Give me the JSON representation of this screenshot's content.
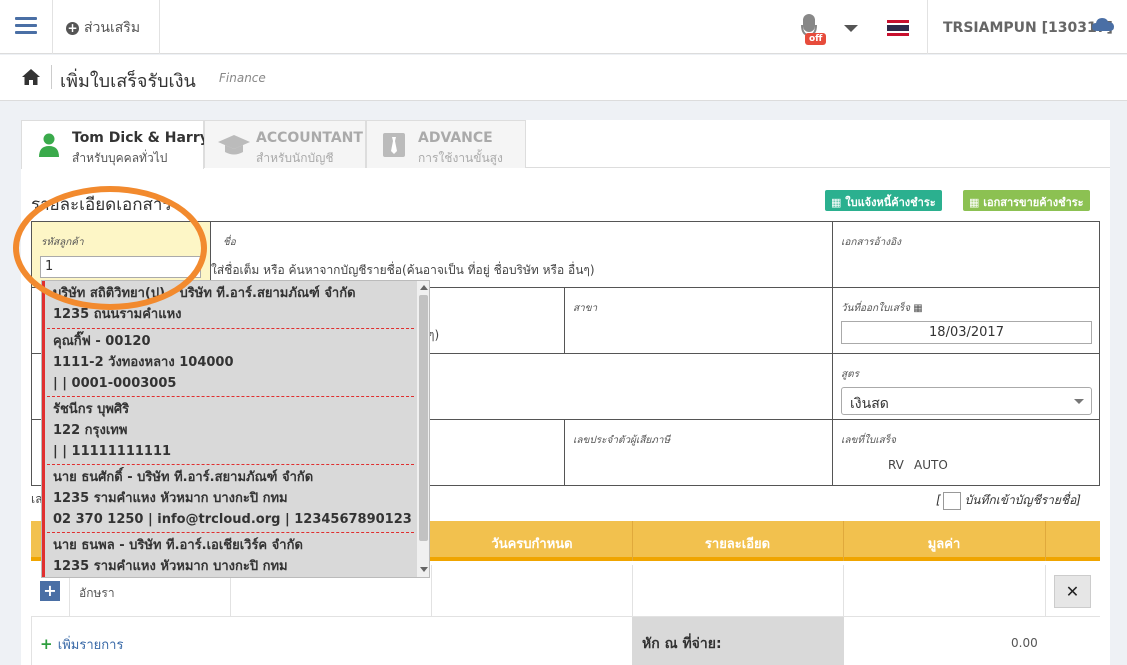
{
  "topbar": {
    "addon_label": "ส่วนเสริม",
    "mic_badge": "off",
    "user": "TRSIAMPUN [130317]"
  },
  "page": {
    "title": "เพิ่มใบเสร็จรับเงิน",
    "subtitle": "Finance"
  },
  "tabs": [
    {
      "title": "Tom Dick & Harry",
      "sub": "สำหรับบุคคลทั่วไป"
    },
    {
      "title": "ACCOUNTANT",
      "sub": "สำหรับนักบัญชี"
    },
    {
      "title": "ADVANCE",
      "sub": "การใช้งานขั้นสูง"
    }
  ],
  "doc": {
    "section_title": "รายละเอียดเอกสาร",
    "btn_invoice": "ใบแจ้งหนี้ค้างชำระ",
    "btn_sales": "เอกสารขายค้างชำระ",
    "customer_code_label": "รหัสลูกค้า",
    "customer_code_value": "1",
    "name_label": "ชื่อ",
    "name_hint": "ใส่ชื่อเต็ม หรือ ค้นหาจากบัญชีรายชื่อ(ค้นอาจเป็น ที่อยู่ ชื่อบริษัท หรือ อื่นๆ)",
    "ref_label": "เอกสารอ้างอิง",
    "branch_label": "สาขา",
    "date_label": "วันที่ออกใบเสร็จ",
    "date_value": "18/03/2017",
    "hidden_hint_tail": "ๆ)",
    "formula_label": "สูตร",
    "formula_value": "เงินสด",
    "taxid_label": "เลขประจำตัวผู้เสียภาษี",
    "receipt_no_label": "เลขที่ใบเสร็จ",
    "receipt_prefix": "RV",
    "receipt_auto": "AUTO",
    "left_stub": "เล",
    "save_contact_label": "บันทึกเข้าบัญชีรายชื่อ]"
  },
  "table": {
    "headers": [
      "วันครบกำหนด",
      "รายละเอียด",
      "มูลค่า"
    ],
    "row_text": "อักษรา",
    "add_line": "เพิ่มรายการ",
    "deduct_label": "หัก ณ ที่จ่าย:",
    "total": "0.00"
  },
  "dropdown": [
    {
      "lines": [
        "บริษัท สถิติวิทยา(ป) - บริษัท ที.อาร์.สยามภัณฑ์ จำกัด",
        "1235 ถนนรามคำแหง"
      ]
    },
    {
      "lines": [
        "คุณกิ๊ฟ - 00120",
        "1111-2 วังทองหลาง 104000",
        "| | 0001-0003005"
      ]
    },
    {
      "lines": [
        "รัชนีกร บุพศิริ",
        "122 กรุงเทพ",
        "| | 11111111111"
      ]
    },
    {
      "lines": [
        "นาย ธนศักดิ์ - บริษัท ที.อาร์.สยามภัณฑ์ จำกัด",
        "1235 รามคำแหง หัวหมาก บางกะปิ กทม",
        "02 370 1250 | info@trcloud.org | 1234567890123"
      ]
    },
    {
      "lines": [
        "นาย ธนพล - บริษัท ที.อาร์.เอเชียเวิร์ค จำกัด",
        "1235 รามคำแหง หัวหมาก บางกะปิ กทม"
      ]
    }
  ],
  "colors": {
    "accent_green": "#2bb673",
    "header_yellow": "#f2c14e",
    "annotation_orange": "#f28a2e",
    "dropdown_red": "#e02f2f"
  }
}
